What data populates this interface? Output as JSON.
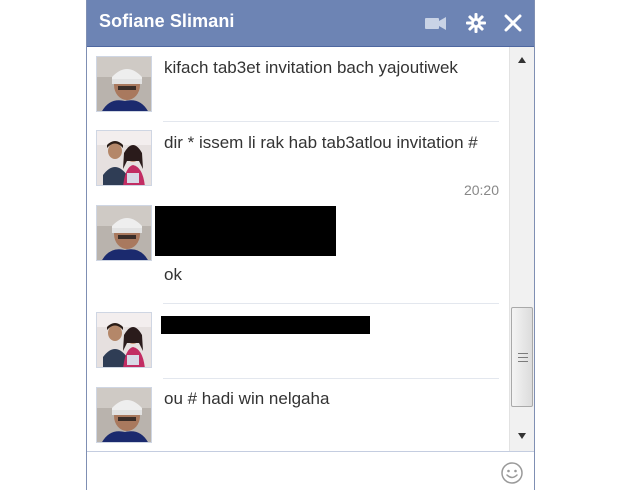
{
  "chat": {
    "contact_name": "Sofiane Slimani",
    "icons": {
      "video": "video-camera-icon",
      "settings": "gear-icon",
      "close": "close-icon",
      "emoticon": "smiley-icon"
    }
  },
  "messages": [
    {
      "sender": "contact",
      "text": "kifach tab3et invitation bach yajoutiwek",
      "timestamp": ""
    },
    {
      "sender": "self",
      "text": "dir * issem li rak hab tab3atlou invitation #",
      "timestamp": "20:20"
    },
    {
      "sender": "contact",
      "text": "ok",
      "timestamp": "",
      "redacted": true
    },
    {
      "sender": "self",
      "text": "",
      "timestamp": "",
      "redacted": true
    },
    {
      "sender": "contact",
      "text": "ou # hadi win nelgaha",
      "timestamp": ""
    }
  ],
  "input": {
    "value": "",
    "placeholder": ""
  },
  "colors": {
    "titlebar": "#6d84b4",
    "text": "#333333",
    "timestamp": "#888888"
  }
}
